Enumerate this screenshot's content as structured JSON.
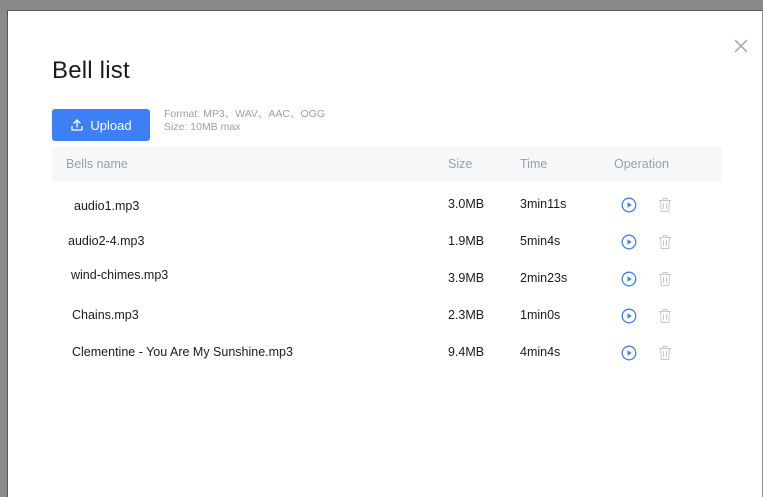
{
  "dialog": {
    "title": "Bell list",
    "close_icon": "close-icon"
  },
  "upload": {
    "label": "Upload",
    "icon": "upload-icon"
  },
  "format_hint": {
    "line1": "Format: MP3、WAV、AAC、OGG",
    "line2": "Size: 10MB max"
  },
  "table": {
    "headers": {
      "name": "Bells name",
      "size": "Size",
      "time": "Time",
      "operation": "Operation"
    },
    "rows": [
      {
        "name": "audio1.mp3",
        "size": "3.0MB",
        "time": "3min11s"
      },
      {
        "name": "audio2-4.mp3",
        "size": "1.9MB",
        "time": "5min4s"
      },
      {
        "name": "wind-chimes.mp3",
        "size": "3.9MB",
        "time": "2min23s"
      },
      {
        "name": "Chains.mp3",
        "size": "2.3MB",
        "time": "1min0s"
      },
      {
        "name": "Clementine - You Are My Sunshine.mp3",
        "size": "9.4MB",
        "time": "4min4s"
      }
    ]
  },
  "colors": {
    "accent": "#3d7ff5",
    "muted_text": "#9aa0a8",
    "header_bg": "#f6f7f9"
  },
  "icons": {
    "play": "play-icon",
    "delete": "trash-icon"
  }
}
